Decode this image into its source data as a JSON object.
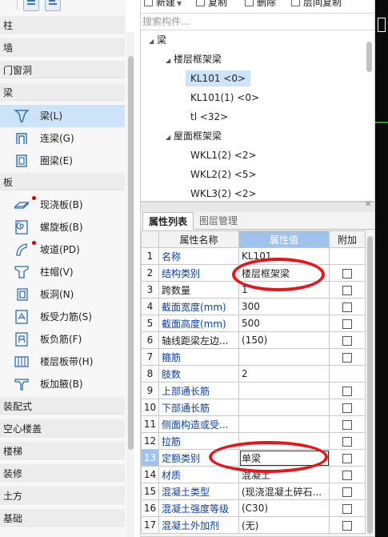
{
  "sidebar": {
    "categories_top": [
      "柱",
      "墙",
      "门窗洞",
      "梁"
    ],
    "beam_items": [
      {
        "label": "梁(L)",
        "icon": "beam-icon",
        "selected": true,
        "new": false
      },
      {
        "label": "连梁(G)",
        "icon": "coupling-beam-icon",
        "selected": false,
        "new": false
      },
      {
        "label": "圈梁(E)",
        "icon": "ring-beam-icon",
        "selected": false,
        "new": false
      }
    ],
    "slab_category": "板",
    "slab_items": [
      {
        "label": "现浇板(B)",
        "icon": "cast-slab-icon",
        "new": true
      },
      {
        "label": "螺旋板(B)",
        "icon": "spiral-slab-icon",
        "new": false
      },
      {
        "label": "坡道(PD)",
        "icon": "ramp-icon",
        "new": true
      },
      {
        "label": "柱帽(V)",
        "icon": "column-cap-icon",
        "new": false
      },
      {
        "label": "板洞(N)",
        "icon": "slab-hole-icon",
        "new": false
      },
      {
        "label": "板受力筋(S)",
        "icon": "slab-main-rebar-icon",
        "new": false
      },
      {
        "label": "板负筋(F)",
        "icon": "slab-negative-rebar-icon",
        "new": false
      },
      {
        "label": "楼层板带(H)",
        "icon": "slab-strip-icon",
        "new": false
      },
      {
        "label": "板加腋(B)",
        "icon": "slab-haunch-icon",
        "new": false
      }
    ],
    "categories_bottom": [
      "装配式",
      "空心楼盖",
      "楼梯",
      "装修",
      "土方",
      "基础"
    ]
  },
  "tree_toolbar": {
    "new_label": "新建",
    "copy_label": "复制",
    "delete_label": "删除",
    "floor_copy_label": "层间复制"
  },
  "search": {
    "placeholder": "搜索构件...",
    "value": ""
  },
  "tree": {
    "root": "梁",
    "group1": "楼层框架梁",
    "group1_items": [
      "KL101 <0>",
      "KL101(1) <0>",
      "tl <32>"
    ],
    "group2": "屋面框架梁",
    "group2_items": [
      "WKL1(2) <2>",
      "WKL2(2) <5>",
      "WKL3(2) <2>"
    ]
  },
  "properties": {
    "tabs": [
      "属性列表",
      "图层管理"
    ],
    "headers": {
      "name": "属性名称",
      "value": "属性值",
      "extra": "附加"
    },
    "rows": [
      {
        "no": "1",
        "name": "名称",
        "value": "KL101",
        "checkbox": false,
        "blue": true
      },
      {
        "no": "2",
        "name": "结构类别",
        "value": "楼层框架梁",
        "checkbox": true,
        "blue": true
      },
      {
        "no": "3",
        "name": "跨数量",
        "value": "1",
        "checkbox": true,
        "blue": false
      },
      {
        "no": "4",
        "name": "截面宽度(mm)",
        "value": "300",
        "checkbox": true,
        "blue": true
      },
      {
        "no": "5",
        "name": "截面高度(mm)",
        "value": "500",
        "checkbox": true,
        "blue": true
      },
      {
        "no": "6",
        "name": "轴线距梁左边...",
        "value": "(150)",
        "checkbox": true,
        "blue": false
      },
      {
        "no": "7",
        "name": "箍筋",
        "value": "",
        "checkbox": true,
        "blue": true
      },
      {
        "no": "8",
        "name": "肢数",
        "value": "2",
        "checkbox": false,
        "blue": true
      },
      {
        "no": "9",
        "name": "上部通长筋",
        "value": "",
        "checkbox": true,
        "blue": true
      },
      {
        "no": "10",
        "name": "下部通长筋",
        "value": "",
        "checkbox": true,
        "blue": true
      },
      {
        "no": "11",
        "name": "侧面构造或受...",
        "value": "",
        "checkbox": true,
        "blue": true
      },
      {
        "no": "12",
        "name": "拉筋",
        "value": "",
        "checkbox": true,
        "blue": true
      },
      {
        "no": "13",
        "name": "定额类别",
        "value": "单梁",
        "checkbox": true,
        "blue": true
      },
      {
        "no": "14",
        "name": "材质",
        "value": "混凝土",
        "checkbox": true,
        "blue": true
      },
      {
        "no": "15",
        "name": "混凝土类型",
        "value": "(现浇混凝土碎石...",
        "checkbox": true,
        "blue": true
      },
      {
        "no": "16",
        "name": "混凝土强度等级",
        "value": "(C30)",
        "checkbox": true,
        "blue": true
      },
      {
        "no": "17",
        "name": "混凝土外加剂",
        "value": "(无)",
        "checkbox": true,
        "blue": true
      }
    ]
  },
  "colors": {
    "accent": "#9fc3ea",
    "selection": "#cde3f7",
    "property_name": "#0b3fa8",
    "annotation": "#e8141b"
  }
}
